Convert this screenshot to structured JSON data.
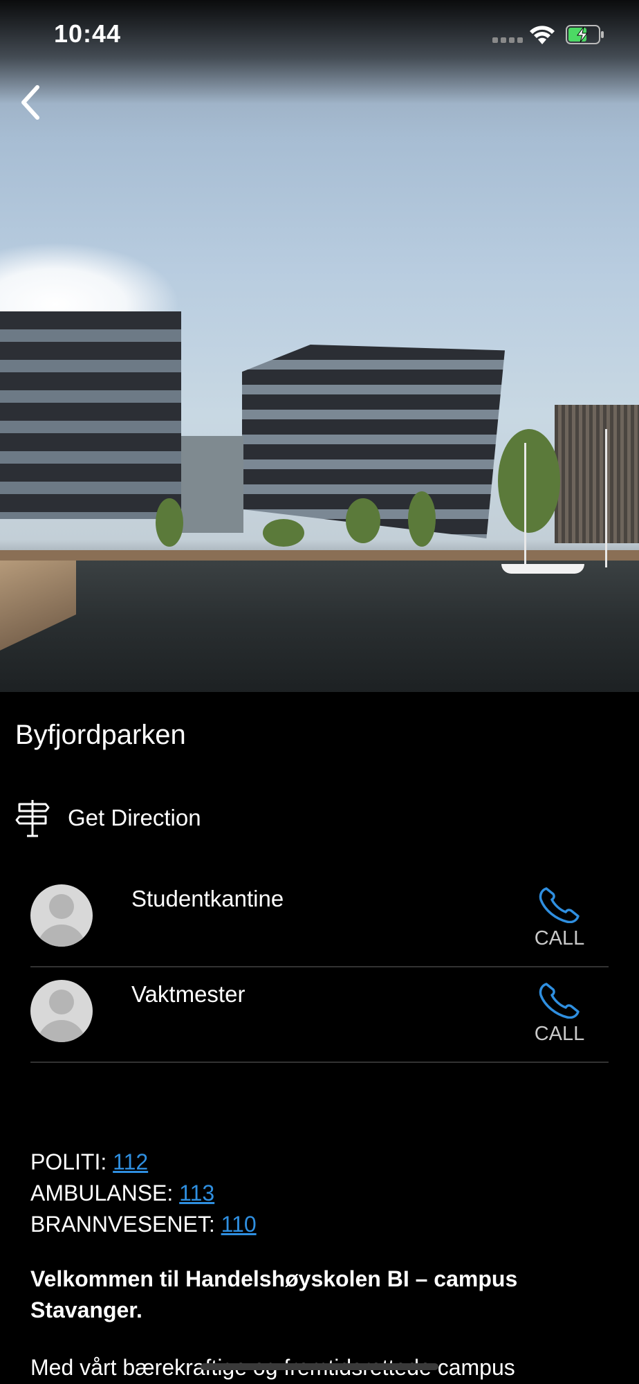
{
  "status_bar": {
    "time": "10:44"
  },
  "hero": {
    "image_alt": "Campus waterfront rendering"
  },
  "place": {
    "title": "Byfjordparken"
  },
  "direction": {
    "label": "Get Direction"
  },
  "contacts": [
    {
      "name": "Studentkantine",
      "call_label": "CALL"
    },
    {
      "name": "Vaktmester",
      "call_label": "CALL"
    }
  ],
  "emergency": [
    {
      "label": "POLITI: ",
      "number": "112"
    },
    {
      "label": "AMBULANSE: ",
      "number": "113"
    },
    {
      "label": "BRANNVESENET: ",
      "number": "110"
    }
  ],
  "welcome": {
    "heading": "Velkommen til Handelshøyskolen BI – campus Stavanger."
  },
  "body": {
    "text": "Med vårt bærekraftige og fremtidsrettede campus"
  },
  "colors": {
    "link": "#2f8fe0",
    "call_icon": "#2f8fe0",
    "background": "#000000"
  }
}
